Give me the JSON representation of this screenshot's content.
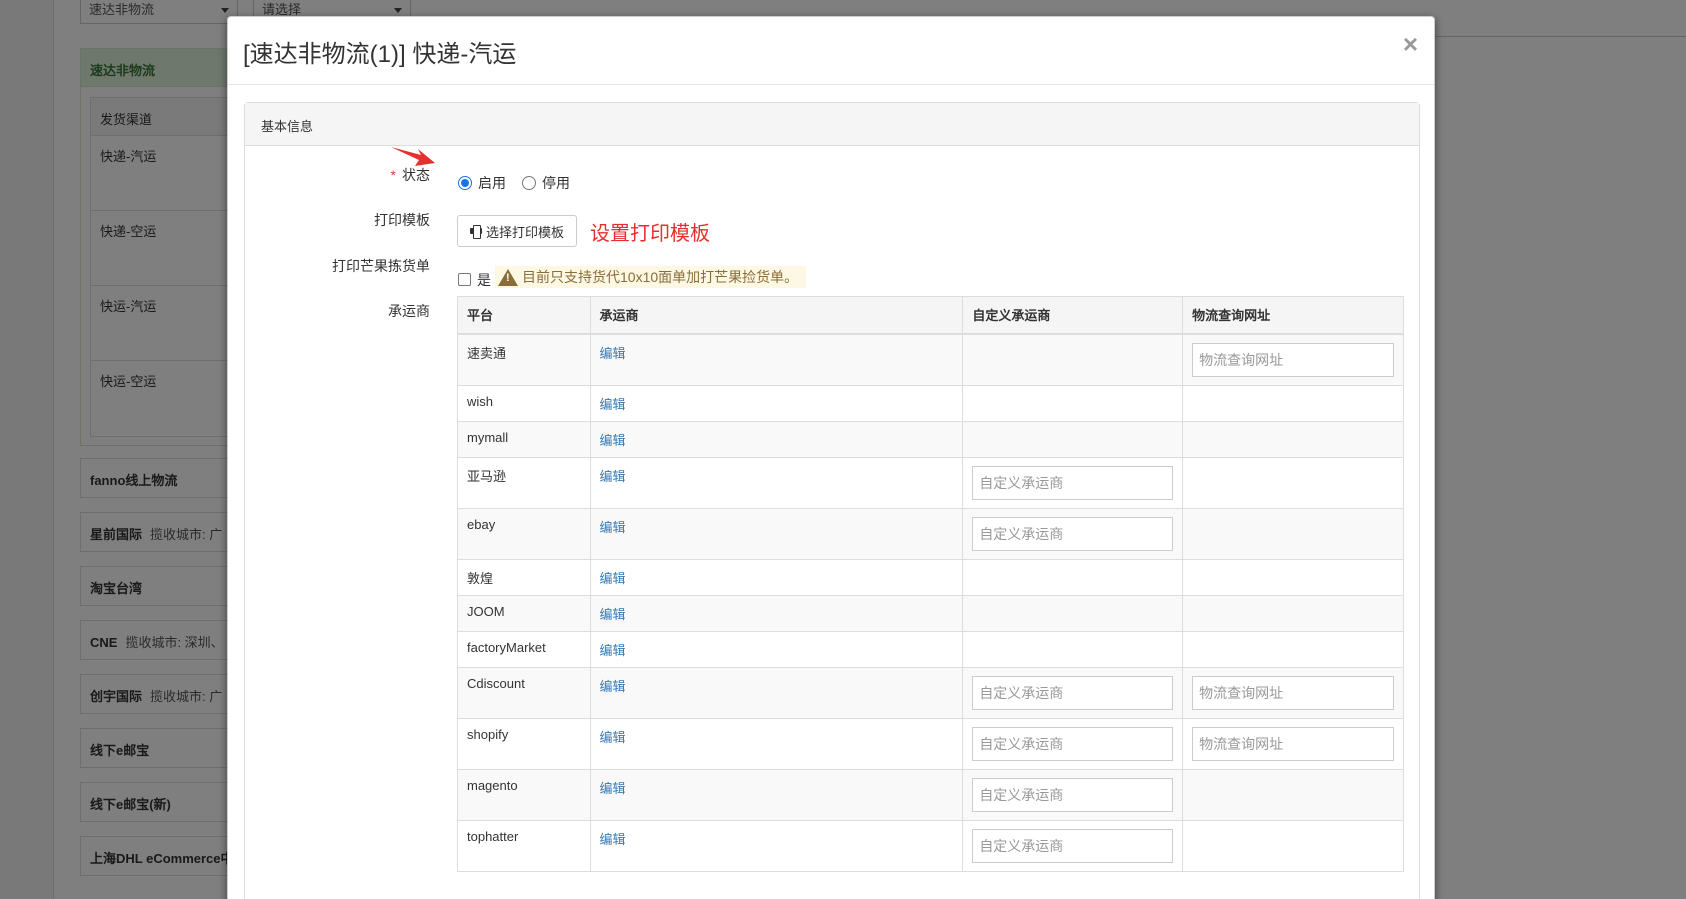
{
  "background": {
    "select_1": "速达非物流",
    "select_2": "请选择",
    "group_title": "速达非物流",
    "channel_header": "发货渠道",
    "channels": [
      "快递-汽运",
      "快递-空运",
      "快运-汽运",
      "快运-空运"
    ],
    "items": [
      {
        "name": "fanno线上物流",
        "sub": ""
      },
      {
        "name": "星前国际",
        "sub": "揽收城市: 广"
      },
      {
        "name": "淘宝台湾",
        "sub": ""
      },
      {
        "name": "CNE",
        "sub": "揽收城市: 深圳、"
      },
      {
        "name": "创宇国际",
        "sub": "揽收城市: 广"
      },
      {
        "name": "线下e邮宝",
        "sub": ""
      },
      {
        "name": "线下e邮宝(新)",
        "sub": ""
      },
      {
        "name": "上海DHL eCommerce中",
        "sub": ""
      }
    ]
  },
  "modal": {
    "title": "[速达非物流(1)] 快递-汽运",
    "close_symbol": "×",
    "panel_heading": "基本信息",
    "status": {
      "label": "状态",
      "required_mark": "*",
      "options": [
        "启用",
        "停用"
      ]
    },
    "print_template": {
      "label": "打印模板",
      "button": "选择打印模板",
      "annotation": "设置打印模板"
    },
    "mango": {
      "label": "打印芒果拣货单",
      "checkbox_text": "是",
      "warning": "目前只支持货代10x10面单加打芒果捡货单。"
    },
    "carriers": {
      "label": "承运商",
      "headers": [
        "平台",
        "承运商",
        "自定义承运商",
        "物流查询网址"
      ],
      "edit_label": "编辑",
      "custom_placeholder": "自定义承运商",
      "url_placeholder": "物流查询网址",
      "rows": [
        {
          "platform": "速卖通",
          "custom": false,
          "url": true
        },
        {
          "platform": "wish",
          "custom": false,
          "url": false
        },
        {
          "platform": "mymall",
          "custom": false,
          "url": false
        },
        {
          "platform": "亚马逊",
          "custom": true,
          "url": false
        },
        {
          "platform": "ebay",
          "custom": true,
          "url": false
        },
        {
          "platform": "敦煌",
          "custom": false,
          "url": false
        },
        {
          "platform": "JOOM",
          "custom": false,
          "url": false
        },
        {
          "platform": "factoryMarket",
          "custom": false,
          "url": false
        },
        {
          "platform": "Cdiscount",
          "custom": true,
          "url": true
        },
        {
          "platform": "shopify",
          "custom": true,
          "url": true
        },
        {
          "platform": "magento",
          "custom": true,
          "url": false
        },
        {
          "platform": "tophatter",
          "custom": true,
          "url": false
        }
      ]
    }
  }
}
